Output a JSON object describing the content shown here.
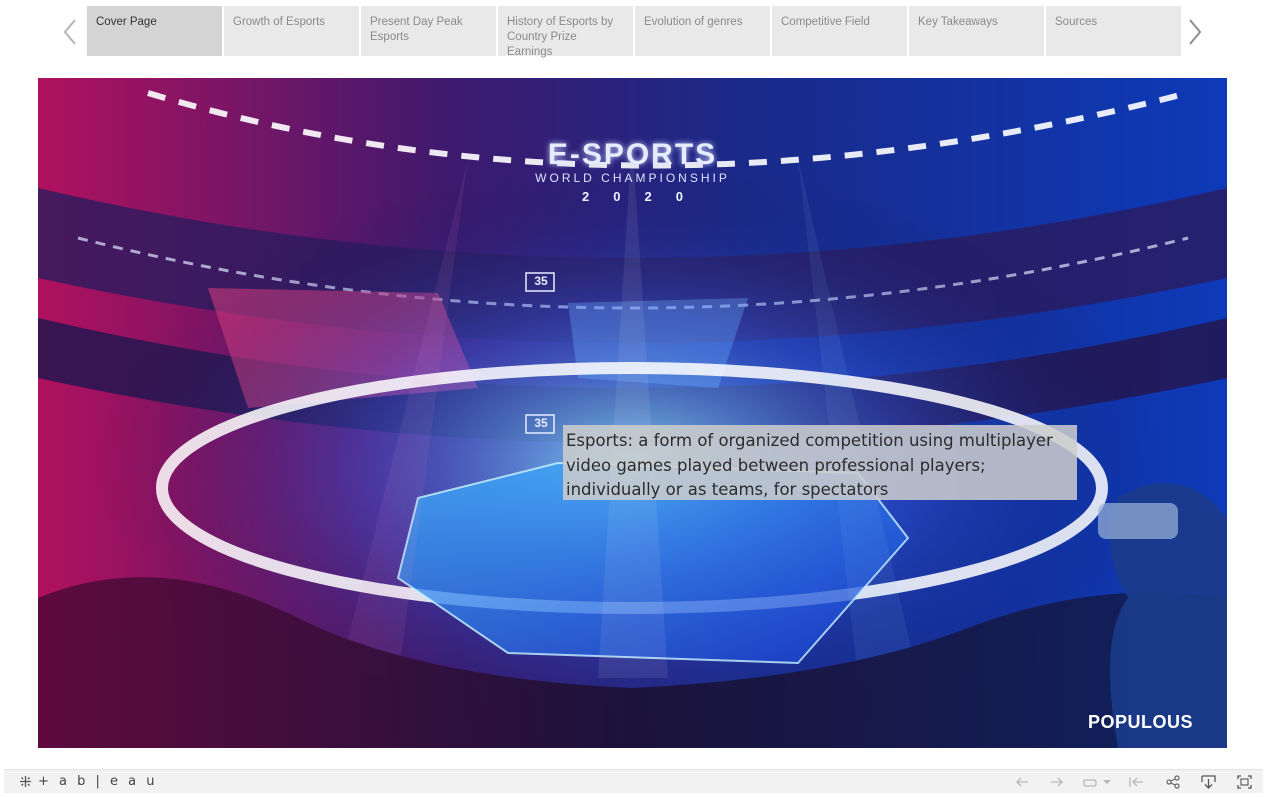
{
  "nav": {
    "prev_icon": "chevron-left-icon",
    "next_icon": "chevron-right-icon",
    "tabs": [
      {
        "label": "Cover Page",
        "active": true
      },
      {
        "label": "Growth of Esports",
        "active": false
      },
      {
        "label": "Present Day Peak Esports",
        "active": false
      },
      {
        "label": "History of Esports by Country Prize Earnings",
        "active": false
      },
      {
        "label": "Evolution of genres",
        "active": false
      },
      {
        "label": "Competitive Field",
        "active": false
      },
      {
        "label": "Key Takeaways",
        "active": false
      },
      {
        "label": "Sources",
        "active": false
      }
    ]
  },
  "hero": {
    "banner_title": "E-SPORTS",
    "banner_subtitle": "WORLD CHAMPIONSHIP",
    "banner_year": "2020",
    "scoreboard_top": "35",
    "scoreboard_mid": "35",
    "caption": "Esports: a form of organized competition using multiplayer video games played between professional players; individually or as teams, for spectators",
    "brand": "POPULOUS"
  },
  "toolbar": {
    "logo_text": "+ a b | e a u",
    "icons": [
      "undo-icon",
      "redo-icon",
      "revert-icon",
      "dropdown-icon",
      "reset-icon",
      "share-icon",
      "download-icon",
      "fullscreen-icon"
    ]
  },
  "colors": {
    "tab_bg": "#e9e9e9",
    "tab_active_bg": "#d4d4d4",
    "caption_bg": "#cdcdcd",
    "arena_magenta": "#d21d7a",
    "arena_blue": "#2a6cf5"
  }
}
